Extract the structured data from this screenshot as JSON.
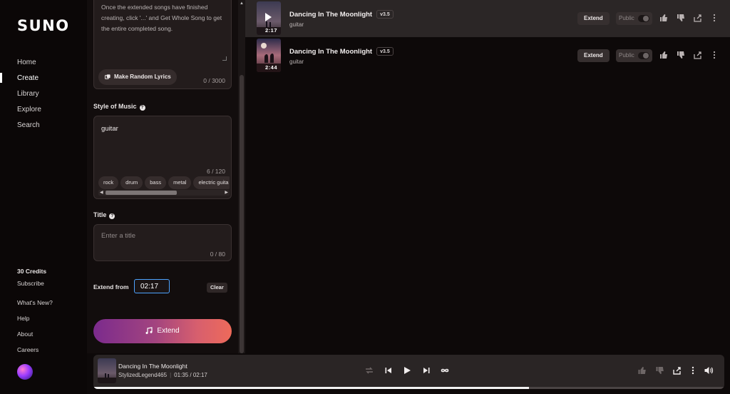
{
  "nav": {
    "logo": "SUNO",
    "items": [
      {
        "label": "Home"
      },
      {
        "label": "Create"
      },
      {
        "label": "Library"
      },
      {
        "label": "Explore"
      },
      {
        "label": "Search"
      }
    ],
    "credits": "30 Credits",
    "subscribe": "Subscribe",
    "whats_new": "What's New?",
    "help": "Help",
    "about": "About",
    "careers": "Careers"
  },
  "create": {
    "lyrics_text": "Once the extended songs have finished creating, click '...' and Get Whole Song to get the entire completed song.",
    "random_lyrics_label": "Make Random Lyrics",
    "lyrics_counter": "0 / 3000",
    "style_label": "Style of Music",
    "style_value": "guitar",
    "style_counter": "6 / 120",
    "style_chips": [
      "rock",
      "drum",
      "bass",
      "metal",
      "electric guita"
    ],
    "title_label": "Title",
    "title_placeholder": "Enter a title",
    "title_counter": "0 / 80",
    "extend_from_label": "Extend from",
    "extend_from_value": "02:17",
    "clear_label": "Clear",
    "extend_button_label": "Extend"
  },
  "songs": [
    {
      "title": "Dancing In The Moonlight",
      "version": "v3.5",
      "style": "guitar",
      "duration": "2:17",
      "extend_label": "Extend",
      "public_label": "Public",
      "selected": true
    },
    {
      "title": "Dancing In The Moonlight",
      "version": "v3.5",
      "style": "guitar",
      "duration": "2:44",
      "extend_label": "Extend",
      "public_label": "Public",
      "selected": false
    }
  ],
  "player": {
    "title": "Dancing In The Moonlight",
    "artist": "StylizedLegend465",
    "time": "01:35 / 02:17",
    "progress": 0.69
  },
  "colors": {
    "accent_gradient_start": "#7b2b8d",
    "accent_gradient_end": "#ee6a5a",
    "focus_blue": "#4da3ff"
  }
}
